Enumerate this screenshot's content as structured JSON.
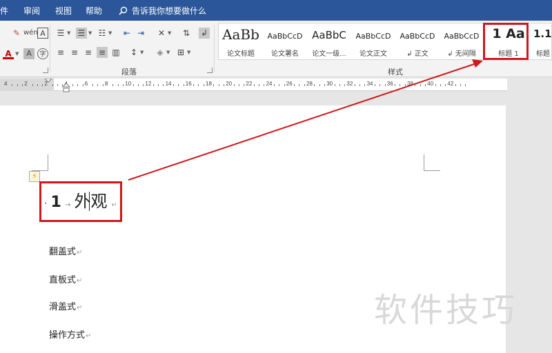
{
  "menubar": {
    "items": [
      "件",
      "审阅",
      "视图",
      "帮助"
    ],
    "tell_me": "告诉我你想要做什么"
  },
  "ribbon": {
    "groups": {
      "paragraph": "段落",
      "styles": "样式"
    },
    "styles": [
      {
        "preview": "AaBb",
        "name": "论文标题"
      },
      {
        "preview": "AaBbCcD",
        "name": "论文署名"
      },
      {
        "preview": "AaBbC",
        "name": "论文一级..."
      },
      {
        "preview": "AaBbCcD",
        "name": "论文正文"
      },
      {
        "preview": "AaBbCcD",
        "name": "↲ 正文"
      },
      {
        "preview": "AaBbCcD",
        "name": "↲ 无间隔"
      },
      {
        "preview": "1  Aa",
        "name": "标题 1"
      },
      {
        "preview": "1.1",
        "name": "标题"
      }
    ]
  },
  "ruler": {
    "numbers": [
      "4",
      "2",
      "2",
      "4",
      "6",
      "8",
      "10",
      "12",
      "14",
      "16",
      "18",
      "20",
      "22",
      "24",
      "26",
      "28",
      "30",
      "32",
      "34",
      "36",
      "38",
      "40",
      "42"
    ]
  },
  "document": {
    "heading_number": "1",
    "heading_text": "外观",
    "paragraphs": [
      "翻盖式",
      "直板式",
      "滑盖式",
      "操作方式"
    ]
  },
  "watermark": "软件技巧",
  "colors": {
    "accent": "#2b579a",
    "highlight": "#d0161c"
  }
}
